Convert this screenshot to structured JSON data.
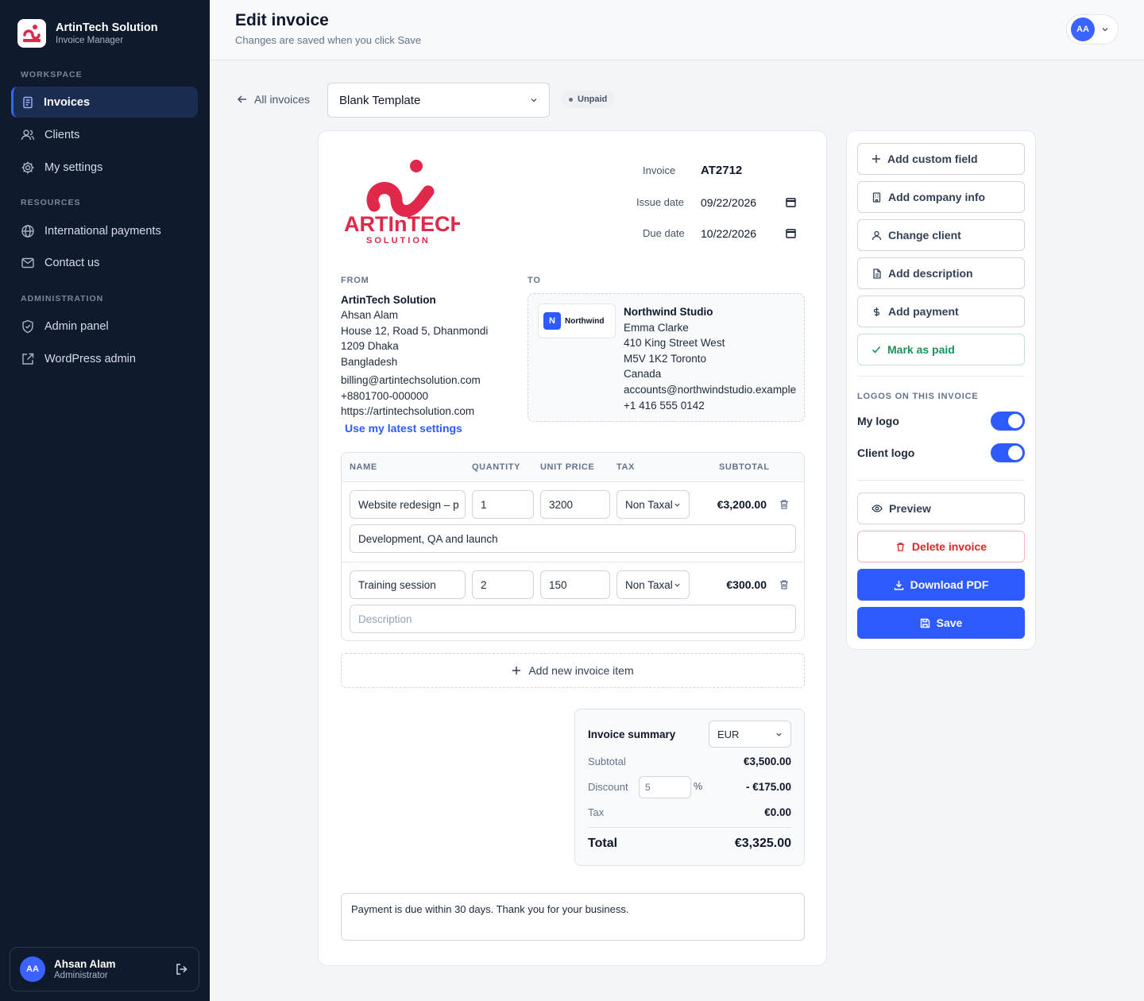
{
  "brand": {
    "name": "ArtinTech Solution",
    "subtitle": "Invoice Manager",
    "logo_text": "ARTInTECH",
    "logo_sub": "SOLUTION"
  },
  "sidebar": {
    "sections": [
      "WORKSPACE",
      "RESOURCES",
      "ADMINISTRATION"
    ],
    "items": [
      {
        "label": "Invoices",
        "icon": "invoice-icon",
        "active": true
      },
      {
        "label": "Clients",
        "icon": "users-icon"
      },
      {
        "label": "My settings",
        "icon": "gear-icon"
      },
      {
        "label": "International payments",
        "icon": "globe-icon"
      },
      {
        "label": "Contact us",
        "icon": "mail-icon"
      },
      {
        "label": "Admin panel",
        "icon": "shield-icon"
      },
      {
        "label": "WordPress admin",
        "icon": "external-link-icon"
      }
    ],
    "user": {
      "initials": "AA",
      "name": "Ahsan Alam",
      "role": "Administrator"
    }
  },
  "header": {
    "title": "Edit invoice",
    "subtitle": "Changes are saved when you click Save",
    "avatar": "AA"
  },
  "toolbar": {
    "back_label": "All invoices",
    "template": "Blank Template",
    "status": "Unpaid"
  },
  "invoice": {
    "number_label": "Invoice",
    "number": "AT2712",
    "issue_label": "Issue date",
    "issue_date": "09/22/2026",
    "due_label": "Due date",
    "due_date": "10/22/2026"
  },
  "from": {
    "heading": "FROM",
    "company": "ArtinTech Solution",
    "lines": [
      "Ahsan Alam",
      "House 12, Road 5, Dhanmondi",
      "1209 Dhaka",
      "Bangladesh"
    ],
    "contact": [
      "billing@artintechsolution.com",
      "+8801700-000000",
      "https://artintechsolution.com"
    ],
    "settings_link": "Use my latest settings"
  },
  "to": {
    "heading": "TO",
    "logo_letter": "N",
    "logo_name": "Northwind",
    "company": "Northwind Studio",
    "lines": [
      "Emma Clarke",
      "410 King Street West",
      "M5V 1K2 Toronto",
      "Canada",
      "accounts@northwindstudio.example",
      "+1 416 555 0142"
    ]
  },
  "items": {
    "headers": [
      "NAME",
      "QUANTITY",
      "UNIT PRICE",
      "TAX",
      "SUBTOTAL"
    ],
    "rows": [
      {
        "name": "Website redesign – p",
        "qty": "1",
        "price": "3200",
        "tax": "Non Taxal",
        "subtotal": "€3,200.00",
        "description": "Development, QA and launch",
        "desc_placeholder": ""
      },
      {
        "name": "Training session",
        "qty": "2",
        "price": "150",
        "tax": "Non Taxal",
        "subtotal": "€300.00",
        "description": "",
        "desc_placeholder": "Description"
      }
    ],
    "add_label": "Add new invoice item"
  },
  "summary": {
    "title": "Invoice summary",
    "currency": "EUR",
    "subtotal_label": "Subtotal",
    "subtotal": "€3,500.00",
    "discount_label": "Discount",
    "discount_value": "5",
    "discount_unit": "%",
    "discount": "- €175.00",
    "tax_label": "Tax",
    "tax": "€0.00",
    "total_label": "Total",
    "total": "€3,325.00"
  },
  "notes": "Payment is due within 30 days. Thank you for your business.",
  "panel": {
    "actions": [
      "Add custom field",
      "Add company info",
      "Change client",
      "Add description",
      "Add payment",
      "Mark as paid"
    ],
    "logos_heading": "LOGOS ON THIS INVOICE",
    "my_logo": "My logo",
    "client_logo": "Client logo",
    "my_logo_on": true,
    "client_logo_on": true,
    "preview": "Preview",
    "delete": "Delete invoice",
    "download": "Download PDF",
    "save": "Save"
  },
  "colors": {
    "accent": "#2e5bff",
    "sidebar": "#0f1b2d",
    "brand_red": "#e0284a",
    "success": "#17925a",
    "danger": "#dc2626"
  }
}
